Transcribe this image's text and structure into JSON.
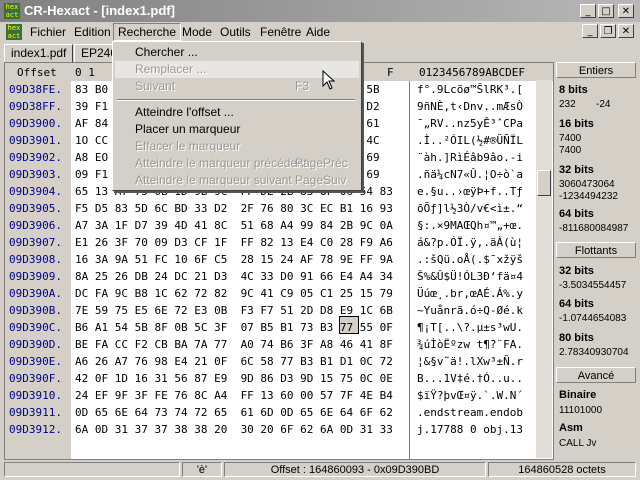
{
  "window": {
    "title": "CR-Hexact - [index1.pdf]",
    "icon_text": "hex\nact"
  },
  "menubar": {
    "items": [
      "Fichier",
      "Edition",
      "Recherche",
      "Mode",
      "Outils",
      "Fenêtre",
      "Aide"
    ]
  },
  "tabs": [
    "index1.pdf",
    "EP240"
  ],
  "hex": {
    "offset_header": "Offset",
    "col_header_left": "0  1",
    "col_header_right": "F",
    "ascii_header": "0123456789ABCDEF",
    "rows": [
      {
        "off": "09D38FE.",
        "hex": "83 B0                                    18 5B",
        "asc": "f°.9Lcõø™ŠlRK³.["
      },
      {
        "off": "09D38FF.",
        "hex": "39 F1                                    73 D2",
        "asc": "9ñNÈ,t‹Dnv..mÆsÒ"
      },
      {
        "off": "09D3900.",
        "hex": "AF 84                                    50 61",
        "asc": "¯„RV..nz5yÊ³ˆCPa"
      },
      {
        "off": "09D3901.",
        "hex": "1O CC                                    CF 4C",
        "asc": ".Ì..²ÓIL(½#®ÜÑÏL"
      },
      {
        "off": "09D3902.",
        "hex": "A8 EO                                    ED 69",
        "asc": "¨àh.]RìÉâb9âo.-i"
      },
      {
        "off": "09D3903.",
        "hex": "09 F1                                    1E 69",
        "asc": ".ñä¼cN7«Û.¦O÷ò`a"
      },
      {
        "off": "09D3904.",
        "hex": "65 13 A7 75 0B 1D 9B 9C  FF DE 2B 83 8F 06 54 83",
        "asc": "e.§u..›œÿÞ+f..Tƒ"
      },
      {
        "off": "09D3905.",
        "hex": "F5 D5 83 5D 6C BD 33 D2  2F 76 80 3C EC B1 16 93",
        "asc": "õÕƒ]l½3Ò/v€<ì±.“"
      },
      {
        "off": "09D3906.",
        "hex": "A7 3A 1F D7 39 4D 41 8C  51 68 A4 99 84 2B 9C 0A",
        "asc": "§:.×9MAŒQh¤™„+œ."
      },
      {
        "off": "09D3907.",
        "hex": "E1 26 3F 70 09 D3 CF 1F  FF 82 13 E4 C0 28 F9 A6",
        "asc": "á&?p.ÓÏ.ÿ‚.äÀ(ù¦"
      },
      {
        "off": "09D3908.",
        "hex": "16 3A 9A 51 FC 10 6F C5  28 15 24 AF 78 9E FF 9A",
        "asc": ".:šQü.oÅ(.$¯xžÿš"
      },
      {
        "off": "09D3909.",
        "hex": "8A 25 26 DB 24 DC 21 D3  4C 33 D0 91 66 E4 A4 34",
        "asc": "Š%&Û$Ü!ÓL3Ð‘fä¤4"
      },
      {
        "off": "09D390A.",
        "hex": "DC FA 9C B8 1C 62 72 82  9C 41 C9 05 C1 25 15 79",
        "asc": "Üúœ¸.br‚œAÉ.Á%.y"
      },
      {
        "off": "09D390B.",
        "hex": "7E 59 75 E5 6E 72 E3 0B  F3 F7 51 2D D8 E9 1C 6B",
        "asc": "~Yuånrã.ó÷Q-Øé.k"
      },
      {
        "off": "09D390C.",
        "hex": "B6 A1 54 5B 8F 0B 5C 3F  07 B5 B1 73 B3 77 55 0F",
        "asc": "¶¡T[..\\?.µ±s³wU."
      },
      {
        "off": "09D390D.",
        "hex": "BE FA CC F2 CB BA 7A 77  A0 74 B6 3F A8 46 41 8F",
        "asc": "¾úÌòËºzw t¶?¨FA."
      },
      {
        "off": "09D390E.",
        "hex": "A6 26 A7 76 98 E4 21 0F  6C 58 77 B3 B1 D1 0C 72",
        "asc": "¦&§v˜ä!.lXw³±Ñ.r"
      },
      {
        "off": "09D390F.",
        "hex": "42 0F 1D 16 31 56 87 E9  9D 86 D3 9D 15 75 0C 0E",
        "asc": "B...1V‡é.†Ó..u.."
      },
      {
        "off": "09D3910.",
        "hex": "24 EF 9F 3F FE 76 8C A4  FF 13 60 00 57 7F 4E B4",
        "asc": "$ïŸ?þvŒ¤ÿ.`.W.N´"
      },
      {
        "off": "09D3911.",
        "hex": "0D 65 6E 64 73 74 72 65  61 6D 0D 65 6E 64 6F 62",
        "asc": ".endstream.endob"
      },
      {
        "off": "09D3912.",
        "hex": "6A 0D 31 37 37 38 38 20  30 20 6F 62 6A 0D 31 33",
        "asc": "j.17788 0 obj.13"
      }
    ]
  },
  "menu_recherche": {
    "items": [
      {
        "label": "Chercher ...",
        "shortcut": "",
        "disabled": false
      },
      {
        "label": "Remplacer ...",
        "shortcut": "",
        "disabled": true
      },
      {
        "label": "Suivant",
        "shortcut": "F3",
        "disabled": true
      },
      {
        "label": "Atteindre l'offset ...",
        "shortcut": "",
        "disabled": false
      },
      {
        "label": "Placer un marqueur",
        "shortcut": "",
        "disabled": false
      },
      {
        "label": "Effacer le marqueur",
        "shortcut": "",
        "disabled": true
      },
      {
        "label": "Atteindre le marqueur précédent",
        "shortcut": "PagePréc",
        "disabled": true
      },
      {
        "label": "Atteindre le marqueur suivant",
        "shortcut": "PageSuiv",
        "disabled": true
      }
    ]
  },
  "panel": {
    "entiers_header": "Entiers",
    "bits8_label": "8 bits",
    "bits8_u": "232",
    "bits8_s": "-24",
    "bits16_label": "16 bits",
    "bits16_a": "7400",
    "bits16_b": "7400",
    "bits32_label": "32 bits",
    "bits32_a": "3060473064",
    "bits32_b": "-1234494232",
    "bits64_label": "64 bits",
    "bits64_a": "-811680084987",
    "flottants_header": "Flottants",
    "f32_label": "32 bits",
    "f32_val": "-3.5034554457",
    "f64_label": "64 bits",
    "f64_val": "-1.0744654083",
    "f80_label": "80 bits",
    "f80_val": "2.78340930704",
    "avance_header": "Avancé",
    "binaire_label": "Binaire",
    "binaire_val": "11101000",
    "asm_label": "Asm",
    "asm_val": "CALL Jv"
  },
  "status": {
    "char": "'è'",
    "offset": "Offset : 164860093  -  0x09D390BD",
    "size": "164860528 octets"
  }
}
